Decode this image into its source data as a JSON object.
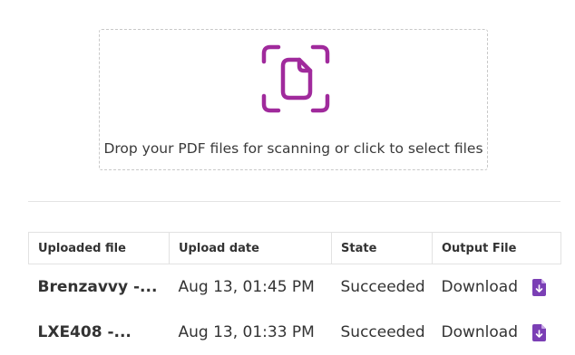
{
  "dropzone": {
    "icon": "scan-document-icon",
    "text": "Drop your PDF files for scanning or click to select files"
  },
  "table": {
    "headers": {
      "file": "Uploaded file",
      "date": "Upload date",
      "state": "State",
      "output": "Output File"
    },
    "rows": [
      {
        "file": "Brenzavvy -...",
        "date": "Aug 13, 01:45 PM",
        "state": "Succeeded",
        "output": "Download",
        "output_icon": "file-download-icon"
      },
      {
        "file": "LXE408 -...",
        "date": "Aug 13, 01:33 PM",
        "state": "Succeeded",
        "output": "Download",
        "output_icon": "file-download-icon"
      }
    ]
  },
  "colors": {
    "accent": "#a02a9c",
    "success": "#4caf50",
    "download_icon": "#7b3fb5"
  }
}
